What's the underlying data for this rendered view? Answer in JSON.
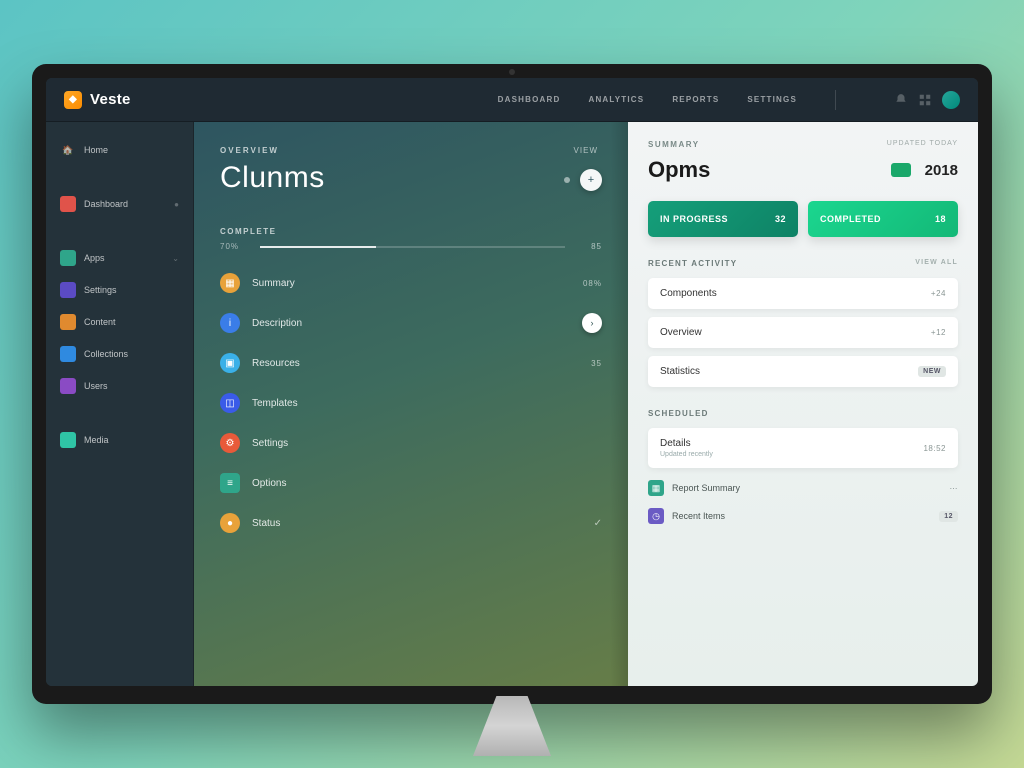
{
  "brand": {
    "name": "Veste"
  },
  "topnav": {
    "links": [
      "DASHBOARD",
      "ANALYTICS",
      "REPORTS",
      "SETTINGS"
    ]
  },
  "sidebar": {
    "items": [
      {
        "label": "Home",
        "icon_bg": "#3a4b55"
      },
      {
        "label": "Dashboard",
        "icon_bg": "#e0534a"
      },
      {
        "label": "Apps",
        "icon_bg": "#2fa58a",
        "chev": true
      },
      {
        "label": "Settings",
        "icon_bg": "#5b4bc4"
      },
      {
        "label": "Content",
        "icon_bg": "#e08a2f"
      },
      {
        "label": "Collections",
        "icon_bg": "#2f8ae0"
      },
      {
        "label": "Users",
        "icon_bg": "#8a4bc4"
      },
      {
        "label": "Media",
        "icon_bg": "#2fc4a5"
      }
    ]
  },
  "mid": {
    "eyebrow": "OVERVIEW",
    "title": "Clunms",
    "top_value": "VIEW",
    "section_label": "COMPLETE",
    "progress_label": "70%",
    "progress_val": "85",
    "list": [
      {
        "label": "Summary",
        "value": "08%",
        "icon_bg": "#e8a23a"
      },
      {
        "label": "Description",
        "value": "",
        "icon_bg": "#3a7de8",
        "circle": true
      },
      {
        "label": "Resources",
        "value": "35",
        "icon_bg": "#3ab0e8"
      },
      {
        "label": "Templates",
        "value": "",
        "icon_bg": "#3a5be8"
      },
      {
        "label": "Settings",
        "value": "",
        "icon_bg": "#e85a3a"
      },
      {
        "label": "Options",
        "value": "",
        "icon_bg": "#2fa58a",
        "square": true
      },
      {
        "label": "Status",
        "value": "",
        "icon_bg": "#e8a23a",
        "check": true
      }
    ]
  },
  "panel": {
    "eyebrow": "SUMMARY",
    "meta": "UPDATED TODAY",
    "title": "Opms",
    "year": "2018",
    "pill_a": {
      "label": "IN PROGRESS",
      "value": "32"
    },
    "pill_b": {
      "label": "COMPLETED",
      "value": "18"
    },
    "section_a": {
      "label": "RECENT ACTIVITY",
      "meta": "VIEW ALL"
    },
    "cards_a": [
      {
        "label": "Components",
        "value": "+24"
      },
      {
        "label": "Overview",
        "value": "+12"
      },
      {
        "label": "Statistics",
        "badge": "NEW"
      }
    ],
    "section_b": {
      "label": "SCHEDULED",
      "meta": ""
    },
    "cards_b": [
      {
        "label": "Details",
        "sub": "Updated recently",
        "value": "18:52"
      }
    ],
    "loose": [
      {
        "label": "Report Summary",
        "icon_bg": "#2fa58a"
      },
      {
        "label": "Recent Items",
        "icon_bg": "#6b5bc4"
      }
    ]
  }
}
